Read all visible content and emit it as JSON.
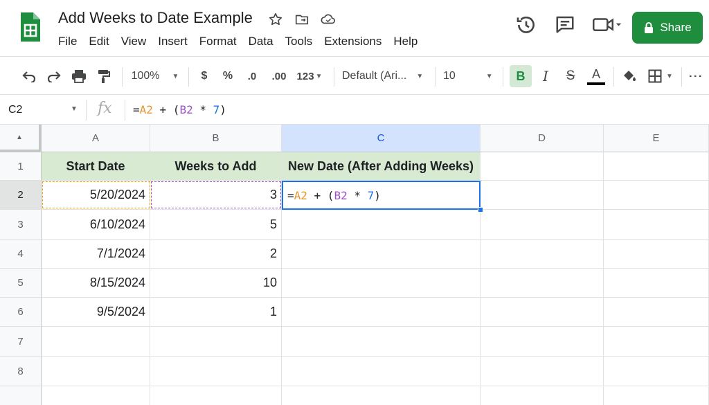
{
  "app": {
    "title": "Add Weeks to Date Example",
    "menu": [
      "File",
      "Edit",
      "View",
      "Insert",
      "Format",
      "Data",
      "Tools",
      "Extensions",
      "Help"
    ],
    "share_label": "Share",
    "title_icons": [
      "star-icon",
      "move-to-folder-icon",
      "cloud-status-icon"
    ],
    "header_icons": [
      "version-history-icon",
      "comments-icon",
      "meet-icon"
    ]
  },
  "toolbar": {
    "zoom": "100%",
    "currency": "$",
    "percent": "%",
    "decrease_decimal": ".0",
    "increase_decimal": ".00",
    "more_formats": "123",
    "font": "Default (Ari...",
    "font_size": "10",
    "bold": "B",
    "italic": "I",
    "strikethrough": "S",
    "text_color": "A",
    "more": "⋮"
  },
  "formula_bar": {
    "name_box": "C2",
    "fx": "fx",
    "formula_parts": {
      "eq": "=",
      "a2": "A2",
      "mid": " + (",
      "b2": "B2",
      "mul": " * ",
      "seven": "7",
      "close": ")"
    }
  },
  "sheet": {
    "columns": [
      "A",
      "B",
      "C",
      "D",
      "E"
    ],
    "rows": [
      "1",
      "2",
      "3",
      "4",
      "5",
      "6",
      "7",
      "8"
    ],
    "headers": {
      "a": "Start Date",
      "b": "Weeks to Add",
      "c": "New Date (After Adding Weeks)"
    },
    "data": [
      {
        "a": "5/20/2024",
        "b": "3"
      },
      {
        "a": "6/10/2024",
        "b": "5"
      },
      {
        "a": "7/1/2024",
        "b": "2"
      },
      {
        "a": "8/15/2024",
        "b": "10"
      },
      {
        "a": "9/5/2024",
        "b": "1"
      }
    ],
    "active_cell": "C2"
  },
  "colors": {
    "brand_green": "#1e8e3e",
    "header_fill": "#d9ead3",
    "selection_blue": "#1a73e8",
    "ref_a": "#e8942b",
    "ref_b": "#9c4fc6"
  }
}
